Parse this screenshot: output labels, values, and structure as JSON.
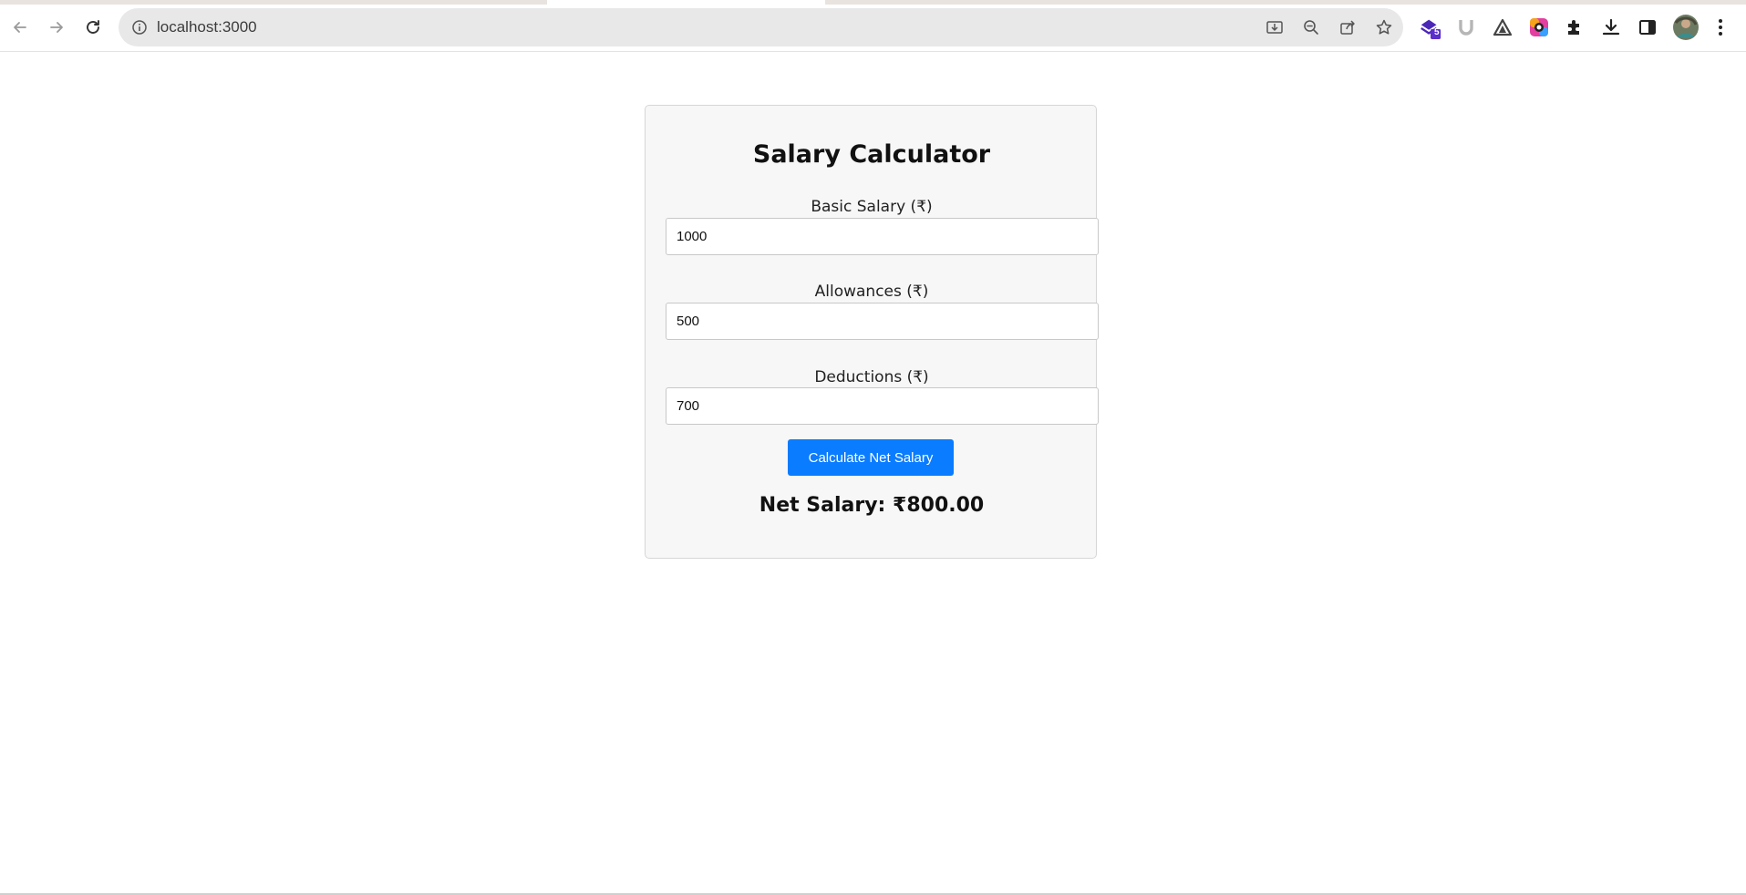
{
  "browser": {
    "url": "localhost:3000",
    "extension_badge": "5",
    "colors": {
      "omnibox_bg": "#e8e8e8",
      "ext_purple": "#5b2fc9"
    },
    "icons": [
      "back-arrow-icon",
      "forward-arrow-icon",
      "reload-icon",
      "site-info-icon",
      "install-app-icon",
      "zoom-out-icon",
      "share-icon",
      "bookmark-star-icon",
      "extension-stack-icon",
      "extension-u-icon",
      "extension-triangle-icon",
      "extension-color-icon",
      "puzzle-icon",
      "download-icon",
      "side-panel-icon",
      "profile-avatar",
      "more-vert-icon"
    ]
  },
  "calculator": {
    "title": "Salary Calculator",
    "fields": {
      "basic": {
        "label": "Basic Salary (₹)",
        "value": "1000"
      },
      "allowances": {
        "label": "Allowances (₹)",
        "value": "500"
      },
      "deductions": {
        "label": "Deductions (₹)",
        "value": "700"
      }
    },
    "button_label": "Calculate Net Salary",
    "result": "Net Salary: ₹800.00",
    "colors": {
      "button_bg": "#0a7cff",
      "card_bg": "#f7f7f7",
      "card_border": "#d6d6d6"
    }
  }
}
